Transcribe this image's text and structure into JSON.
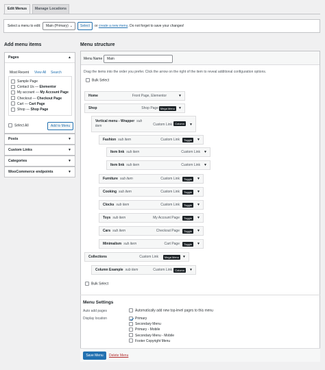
{
  "tabs": [
    "Edit Menus",
    "Manage Locations"
  ],
  "select_bar": {
    "label": "Select a menu to edit:",
    "selected": "Main (Primary)",
    "select_button": "Select",
    "or": "or",
    "create_link": "create a new menu",
    "tail": ". Do not forget to save your changes!"
  },
  "left": {
    "title": "Add menu items",
    "pages_title": "Pages",
    "page_tabs": [
      "Most Recent",
      "View All",
      "Search"
    ],
    "pages": [
      {
        "name": "Sample Page",
        "suffix": ""
      },
      {
        "name": "Contact Us — ",
        "suffix": "Elementor"
      },
      {
        "name": "My account — ",
        "suffix": "My Account Page"
      },
      {
        "name": "Checkout — ",
        "suffix": "Checkout Page"
      },
      {
        "name": "Cart — ",
        "suffix": "Cart Page"
      },
      {
        "name": "Shop — ",
        "suffix": "Shop Page"
      }
    ],
    "select_all": "Select All",
    "add_button": "Add to Menu",
    "sections": [
      "Posts",
      "Custom Links",
      "Categories",
      "WooCommerce endpoints"
    ]
  },
  "right": {
    "title": "Menu structure",
    "menu_name_label": "Menu Name",
    "menu_name_value": "Main",
    "instructions": "Drag the items into the order you prefer. Click the arrow on the right of the item to reveal additional configuration options.",
    "bulk_select": "Bulk Select",
    "items": [
      {
        "title": "Home",
        "sub": "",
        "type": "Front Page, Elementor",
        "badge": ""
      },
      {
        "title": "Shop",
        "sub": "",
        "type": "Shop Page",
        "badge": "Mega Menu"
      },
      {
        "title": "Vertical menu - Wrapper",
        "sub": "sub item",
        "type": "Custom Link",
        "badge": "Column"
      },
      {
        "title": "Fashion",
        "sub": "sub item",
        "type": "Custom Link",
        "badge": "Toggle"
      },
      {
        "title": "Item link",
        "sub": "sub item",
        "type": "Custom Link",
        "badge": ""
      },
      {
        "title": "Item link",
        "sub": "sub item",
        "type": "Custom Link",
        "badge": ""
      },
      {
        "title": "Furniture",
        "sub": "sub item",
        "type": "Custom Link",
        "badge": "Toggle"
      },
      {
        "title": "Cooking",
        "sub": "sub item",
        "type": "Custom Link",
        "badge": "Toggle"
      },
      {
        "title": "Clocks",
        "sub": "sub item",
        "type": "Custom Link",
        "badge": "Toggle"
      },
      {
        "title": "Toys",
        "sub": "sub item",
        "type": "My Account Page",
        "badge": "Toggle"
      },
      {
        "title": "Cars",
        "sub": "sub item",
        "type": "Checkout Page",
        "badge": "Toggle"
      },
      {
        "title": "Minimalism",
        "sub": "sub item",
        "type": "Cart Page",
        "badge": "Toggle"
      },
      {
        "title": "Collections",
        "sub": "",
        "type": "Custom Link",
        "badge": "Mega Menu"
      },
      {
        "title": "Column Example",
        "sub": "sub item",
        "type": "Custom Link",
        "badge": "Column"
      }
    ],
    "settings_title": "Menu Settings",
    "auto_add_label": "Auto add pages",
    "auto_add_text": "Automatically add new top-level pages to this menu",
    "display_location_label": "Display location",
    "locations": [
      {
        "name": "Primary",
        "checked": true
      },
      {
        "name": "Secondary Menu",
        "checked": false
      },
      {
        "name": "Primary - Mobile",
        "checked": false
      },
      {
        "name": "Secondary Menu - Mobile",
        "checked": false
      },
      {
        "name": "Footer Copyright Menu",
        "checked": false
      }
    ],
    "save_button": "Save Menu",
    "delete_link": "Delete Menu"
  },
  "colors": {
    "accent": "#2271b1",
    "badge": "#1d2327",
    "background": "#f0f0f1"
  }
}
